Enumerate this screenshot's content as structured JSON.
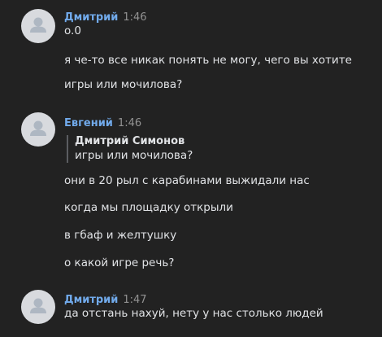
{
  "colors": {
    "background": "#222222",
    "author_name": "#71aaeb",
    "timestamp": "#939393",
    "message_text": "#e1e3e6",
    "avatar_bg": "#d8dade",
    "avatar_icon": "#aeb7c2"
  },
  "messages": [
    {
      "author": "Дмитрий",
      "time": "1:46",
      "avatar_icon": "user-placeholder-icon",
      "lines": [
        "o.0",
        "я че-то все никак понять не могу, чего вы хотите",
        "игры или мочилова?"
      ]
    },
    {
      "author": "Евгений",
      "time": "1:46",
      "avatar_icon": "user-placeholder-icon",
      "quote": {
        "author": "Дмитрий Симонов",
        "text": "игры или мочилова?"
      },
      "lines": [
        "они в 20 рыл с карабинами выжидали нас",
        "когда мы площадку открыли",
        "в гбаф и желтушку",
        "о какой игре речь?"
      ]
    },
    {
      "author": "Дмитрий",
      "time": "1:47",
      "avatar_icon": "user-placeholder-icon",
      "lines": [
        "да отстань нахуй, нету у нас столько людей"
      ]
    }
  ]
}
